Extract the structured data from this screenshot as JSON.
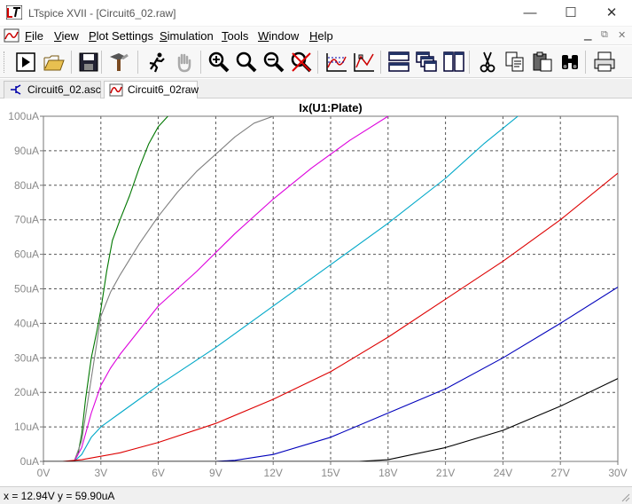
{
  "window": {
    "title": "LTspice XVII - [Circuit6_02.raw]",
    "min_glyph": "—",
    "max_glyph": "☐",
    "close_glyph": "✕"
  },
  "menu": [
    {
      "label": "File",
      "u": "F",
      "rest": "ile"
    },
    {
      "label": "View",
      "u": "V",
      "rest": "iew"
    },
    {
      "label": "Plot Settings",
      "u": "P",
      "rest": "lot Settings"
    },
    {
      "label": "Simulation",
      "u": "S",
      "rest": "imulation"
    },
    {
      "label": "Tools",
      "u": "T",
      "rest": "ools"
    },
    {
      "label": "Window",
      "u": "W",
      "rest": "indow"
    },
    {
      "label": "Help",
      "u": "H",
      "rest": "elp"
    }
  ],
  "mdi": {
    "min": "▁",
    "restore": "⧉",
    "close": "✕"
  },
  "toolbar_icons": [
    "run-icon",
    "open-icon",
    "save-icon",
    "control-panel-icon",
    "running-man-icon",
    "pan-hand-icon",
    "zoom-in-icon",
    "zoom-full-icon",
    "zoom-out-icon",
    "zoom-cancel-icon",
    "autorange-icon",
    "mark-data-icon",
    "tile-horizontal-icon",
    "cascade-icon",
    "tile-vertical-icon",
    "cut-icon",
    "copy-icon",
    "paste-icon",
    "find-icon",
    "print-icon"
  ],
  "tabs": [
    {
      "label": "Circuit6_02.asc",
      "icon": "schematic-icon",
      "active": false
    },
    {
      "label": "Circuit6_02raw",
      "icon": "waveform-icon",
      "active": true
    }
  ],
  "status": {
    "text": "x = 12.94V   y = 59.90uA"
  },
  "chart_data": {
    "type": "line",
    "title": "Ix(U1:Plate)",
    "xlabel": "",
    "ylabel": "",
    "xlim": [
      0,
      30
    ],
    "ylim": [
      0,
      100
    ],
    "grid": true,
    "x_ticks": [
      0,
      3,
      6,
      9,
      12,
      15,
      18,
      21,
      24,
      27,
      30
    ],
    "x_tick_labels": [
      "0V",
      "3V",
      "6V",
      "9V",
      "12V",
      "15V",
      "18V",
      "21V",
      "24V",
      "27V",
      "30V"
    ],
    "y_ticks": [
      0,
      10,
      20,
      30,
      40,
      50,
      60,
      70,
      80,
      90,
      100
    ],
    "y_tick_labels": [
      "0uA",
      "10uA",
      "20uA",
      "30uA",
      "40uA",
      "50uA",
      "60uA",
      "70uA",
      "80uA",
      "90uA",
      "100uA"
    ],
    "series": [
      {
        "color": "#007700",
        "x": [
          0,
          1.6,
          1.8,
          2.0,
          2.2,
          2.5,
          2.8,
          3.0,
          3.3,
          3.6,
          4.0,
          4.5,
          5.0,
          5.5,
          6.0,
          6.5
        ],
        "y": [
          0,
          0,
          2,
          8,
          18,
          30,
          38,
          44,
          55,
          64,
          70,
          77,
          85,
          92,
          97,
          100
        ]
      },
      {
        "color": "#808080",
        "x": [
          0,
          1.6,
          2.0,
          2.5,
          3.0,
          3.5,
          4.0,
          5.0,
          6.0,
          7.0,
          8.0,
          9.0,
          10.0,
          11.0,
          12.0
        ],
        "y": [
          0,
          0,
          6,
          24,
          42,
          49,
          54,
          63,
          71,
          78,
          84,
          89,
          94,
          98,
          100
        ]
      },
      {
        "color": "#dd00dd",
        "x": [
          0,
          1.6,
          2.0,
          2.5,
          3.0,
          3.5,
          4.0,
          6.0,
          8.0,
          10.0,
          12.0,
          14.0,
          16.0,
          18.0
        ],
        "y": [
          0,
          0,
          4,
          14,
          22,
          27,
          31,
          45,
          55,
          66,
          76,
          85,
          93,
          100
        ]
      },
      {
        "color": "#00a8c8",
        "x": [
          0,
          1.6,
          2.0,
          2.5,
          3.0,
          3.5,
          4.0,
          6.0,
          9.0,
          12.0,
          15.0,
          18.0,
          21.0,
          23.0,
          25.0
        ],
        "y": [
          0,
          0,
          2,
          7,
          10,
          12,
          14,
          22,
          33,
          45,
          57,
          69,
          82,
          92,
          101
        ]
      },
      {
        "color": "#dd0000",
        "x": [
          0,
          1.0,
          2.0,
          3.0,
          4.0,
          6.0,
          9.0,
          12.0,
          15.0,
          18.0,
          21.0,
          24.0,
          27.0,
          30.0
        ],
        "y": [
          0,
          0,
          0.5,
          1.5,
          2.5,
          5.5,
          11,
          18,
          26,
          36,
          47,
          58,
          70,
          83.5
        ]
      },
      {
        "color": "#0000bb",
        "x": [
          0,
          9.0,
          10.0,
          12.0,
          15.0,
          18.0,
          21.0,
          24.0,
          27.0,
          30.0
        ],
        "y": [
          0,
          0,
          0.3,
          2,
          7,
          14,
          21,
          30,
          40,
          50.5
        ]
      },
      {
        "color": "#000000",
        "x": [
          0,
          16.5,
          18.0,
          21.0,
          24.0,
          27.0,
          30.0
        ],
        "y": [
          0,
          0,
          0.5,
          4,
          9,
          16,
          24
        ]
      }
    ]
  }
}
